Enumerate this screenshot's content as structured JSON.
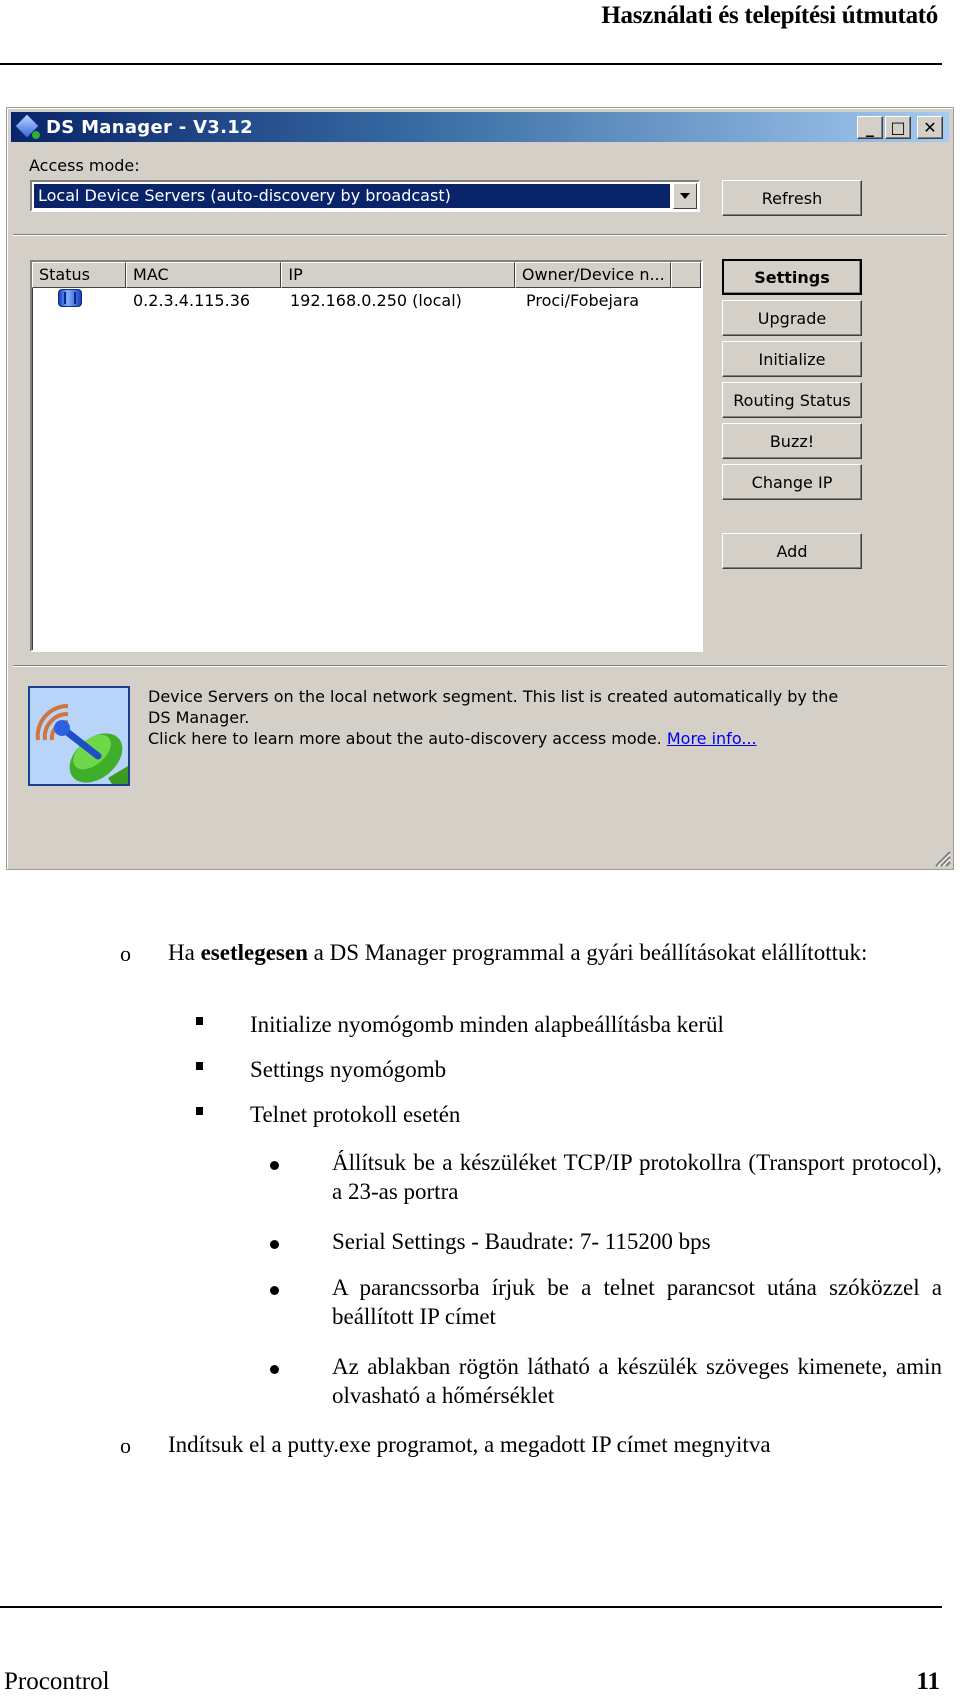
{
  "page": {
    "header_title": "Használati és telepítési útmutató",
    "footer_left": "Procontrol",
    "page_number": "11"
  },
  "window": {
    "title": "DS Manager - V3.12",
    "controls": {
      "minimize": "_",
      "maximize": "□",
      "close": "✕"
    },
    "access_mode_label": "Access mode:",
    "access_mode_value": "Local Device Servers (auto-discovery by broadcast)",
    "buttons": {
      "refresh": "Refresh",
      "settings": "Settings",
      "upgrade": "Upgrade",
      "initialize": "Initialize",
      "routing_status": "Routing Status",
      "buzz": "Buzz!",
      "change_ip": "Change IP",
      "add": "Add"
    },
    "table": {
      "columns": [
        "Status",
        "MAC",
        "IP",
        "Owner/Device n..."
      ],
      "rows": [
        {
          "status_icon": "device-server-icon",
          "mac": "0.2.3.4.115.36",
          "ip": "192.168.0.250 (local)",
          "owner": "Proci/Fobejara"
        }
      ]
    },
    "info": {
      "icon": "satellite-dish-icon",
      "line1": "Device Servers on the local network segment. This list is created automatically by the DS Manager.",
      "line2": "Click here to learn more about the auto-discovery access mode. ",
      "link": "More info..."
    }
  },
  "doc": {
    "item1_pre": "Ha ",
    "item1_bold": "esetlegesen",
    "item1_post": " a DS Manager programmal a gyári beállításokat elállítottuk:",
    "sub": [
      "Initialize nyomógomb minden alapbeállításba kerül",
      "Settings nyomógomb",
      "Telnet protokoll esetén"
    ],
    "subsub": [
      "Állítsuk be a készüléket TCP/IP protokollra (Transport protocol), a 23-as portra",
      "Serial Settings - Baudrate: 7- 115200 bps",
      "A parancssorba írjuk be a telnet parancsot utána szóközzel a beállított IP címet",
      "Az ablakban rögtön látható a készülék szöveges kimenete, amin olvasható a hőmérséklet"
    ],
    "item2": "Indítsuk el a putty.exe programot, a megadott IP címet megnyitva",
    "bullet_o": "o"
  }
}
